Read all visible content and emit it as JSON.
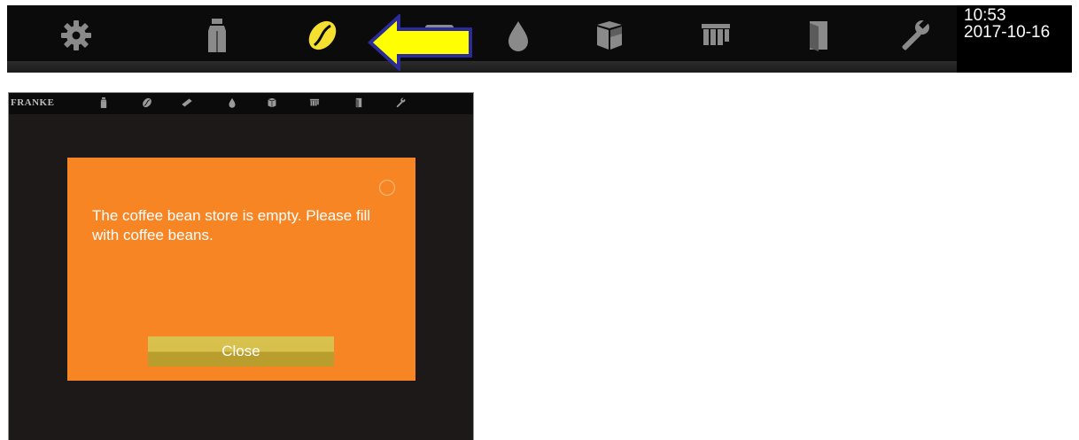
{
  "toolbar": {
    "icons": [
      {
        "name": "gear-icon",
        "state": "inactive"
      },
      {
        "name": "milk-carton-icon",
        "state": "inactive"
      },
      {
        "name": "coffee-bean-icon",
        "state": "active"
      },
      {
        "name": "grounds-container-icon",
        "state": "inactive"
      },
      {
        "name": "water-drop-icon",
        "state": "inactive"
      },
      {
        "name": "box-icon",
        "state": "inactive"
      },
      {
        "name": "cup-tray-icon",
        "state": "inactive"
      },
      {
        "name": "door-icon",
        "state": "inactive"
      },
      {
        "name": "wrench-icon",
        "state": "inactive"
      }
    ],
    "time": "10:53",
    "date": "2017-10-16",
    "highlight_arrow_color": "#ffff00",
    "active_icon_color": "#f5e030"
  },
  "device": {
    "brand": "FRANKE",
    "mini_icons": [
      "milk-carton-icon",
      "coffee-bean-icon",
      "grounds-container-icon",
      "water-drop-icon",
      "box-icon",
      "cup-tray-icon",
      "door-icon",
      "wrench-icon"
    ],
    "dialog": {
      "message": "The coffee bean store is empty. Please fill with coffee beans.",
      "close_label": "Close",
      "background_color": "#f78524"
    }
  }
}
